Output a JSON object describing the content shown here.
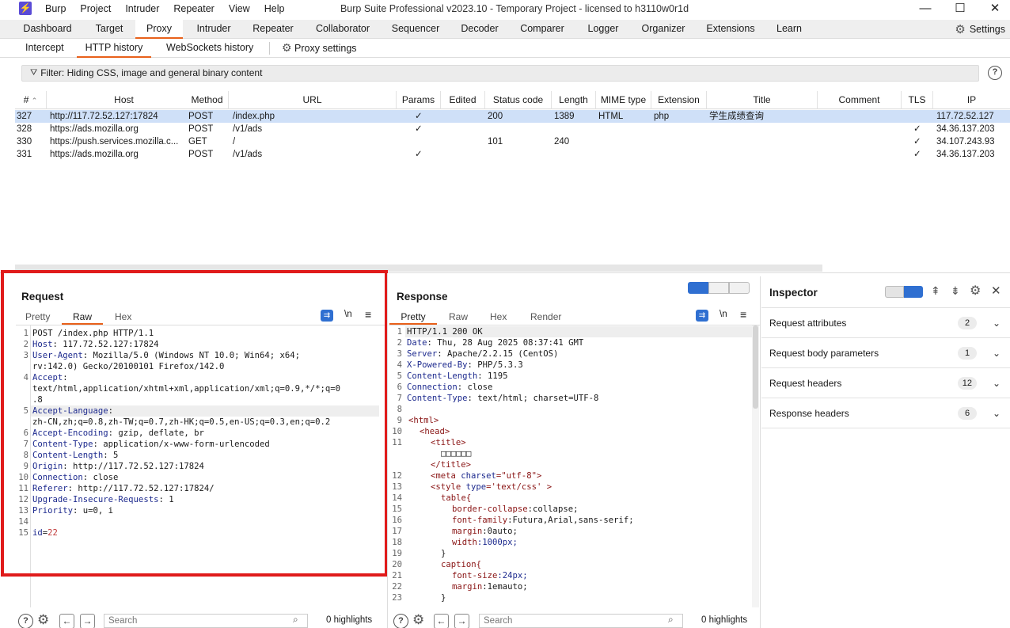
{
  "app": {
    "title": "Burp Suite Professional v2023.10 - Temporary Project - licensed to h3110w0r1d",
    "menu": [
      "Burp",
      "Project",
      "Intruder",
      "Repeater",
      "View",
      "Help"
    ],
    "logo_glyph": "⚡"
  },
  "top_tabs": [
    "Dashboard",
    "Target",
    "Proxy",
    "Intruder",
    "Repeater",
    "Collaborator",
    "Sequencer",
    "Decoder",
    "Comparer",
    "Logger",
    "Organizer",
    "Extensions",
    "Learn"
  ],
  "settings_label": "Settings",
  "sub_tabs": [
    "Intercept",
    "HTTP history",
    "WebSockets history"
  ],
  "proxy_settings_label": "Proxy settings",
  "filter_text": "Filter: Hiding CSS, image and general binary content",
  "columns": [
    "#",
    "Host",
    "Method",
    "URL",
    "Params",
    "Edited",
    "Status code",
    "Length",
    "MIME type",
    "Extension",
    "Title",
    "Comment",
    "TLS",
    "IP"
  ],
  "rows": [
    {
      "id": "327",
      "host": "http://117.72.52.127:17824",
      "method": "POST",
      "url": "/index.php",
      "params": "✓",
      "edited": "",
      "status": "200",
      "length": "1389",
      "mime": "HTML",
      "ext": "php",
      "title": "学生成绩查询",
      "comment": "",
      "tls": "",
      "ip": "117.72.52.127"
    },
    {
      "id": "328",
      "host": "https://ads.mozilla.org",
      "method": "POST",
      "url": "/v1/ads",
      "params": "✓",
      "edited": "",
      "status": "",
      "length": "",
      "mime": "",
      "ext": "",
      "title": "",
      "comment": "",
      "tls": "✓",
      "ip": "34.36.137.203"
    },
    {
      "id": "330",
      "host": "https://push.services.mozilla.c...",
      "method": "GET",
      "url": "/",
      "params": "",
      "edited": "",
      "status": "101",
      "length": "240",
      "mime": "",
      "ext": "",
      "title": "",
      "comment": "",
      "tls": "✓",
      "ip": "34.107.243.93"
    },
    {
      "id": "331",
      "host": "https://ads.mozilla.org",
      "method": "POST",
      "url": "/v1/ads",
      "params": "✓",
      "edited": "",
      "status": "",
      "length": "",
      "mime": "",
      "ext": "",
      "title": "",
      "comment": "",
      "tls": "✓",
      "ip": "34.36.137.203"
    }
  ],
  "request": {
    "title": "Request",
    "tabs": [
      "Pretty",
      "Raw",
      "Hex"
    ],
    "active_tab": "Raw",
    "newline_label": "\\n",
    "lines": [
      {
        "n": "1",
        "text": "POST /index.php HTTP/1.1"
      },
      {
        "n": "2",
        "key": "Host",
        "val": ": 117.72.52.127:17824"
      },
      {
        "n": "3",
        "key": "User-Agent",
        "val": ": Mozilla/5.0 (Windows NT 10.0; Win64; x64;"
      },
      {
        "n": "",
        "text": "rv:142.0) Gecko/20100101 Firefox/142.0"
      },
      {
        "n": "4",
        "key": "Accept",
        "val": ":"
      },
      {
        "n": "",
        "text": "text/html,application/xhtml+xml,application/xml;q=0.9,*/*;q=0"
      },
      {
        "n": "",
        "text": ".8"
      },
      {
        "n": "5",
        "key": "Accept-Language",
        "val": ":"
      },
      {
        "n": "",
        "text": "zh-CN,zh;q=0.8,zh-TW;q=0.7,zh-HK;q=0.5,en-US;q=0.3,en;q=0.2"
      },
      {
        "n": "6",
        "key": "Accept-Encoding",
        "val": ": gzip, deflate, br"
      },
      {
        "n": "7",
        "key": "Content-Type",
        "val": ": application/x-www-form-urlencoded"
      },
      {
        "n": "8",
        "key": "Content-Length",
        "val": ": 5"
      },
      {
        "n": "9",
        "key": "Origin",
        "val": ": http://117.72.52.127:17824"
      },
      {
        "n": "10",
        "key": "Connection",
        "val": ": close"
      },
      {
        "n": "11",
        "key": "Referer",
        "val": ": http://117.72.52.127:17824/"
      },
      {
        "n": "12",
        "key": "Upgrade-Insecure-Requests",
        "val": ": 1"
      },
      {
        "n": "13",
        "key": "Priority",
        "val": ": u=0, i"
      },
      {
        "n": "14",
        "text": ""
      },
      {
        "n": "15",
        "param": "id",
        "pval": "22"
      }
    ],
    "search_placeholder": "Search",
    "highlights": "0 highlights"
  },
  "response": {
    "title": "Response",
    "tabs": [
      "Pretty",
      "Raw",
      "Hex",
      "Render"
    ],
    "active_tab": "Pretty",
    "newline_label": "\\n",
    "lines": [
      {
        "n": "1",
        "text": "HTTP/1.1 200 OK"
      },
      {
        "n": "2",
        "key": "Date",
        "val": ": Thu, 28 Aug 2025 08:37:41 GMT"
      },
      {
        "n": "3",
        "key": "Server",
        "val": ": Apache/2.2.15 (CentOS)"
      },
      {
        "n": "4",
        "key": "X-Powered-By",
        "val": ": PHP/5.3.3"
      },
      {
        "n": "5",
        "key": "Content-Length",
        "val": ": 1195"
      },
      {
        "n": "6",
        "key": "Connection",
        "val": ": close"
      },
      {
        "n": "7",
        "key": "Content-Type",
        "val": ": text/html; charset=UTF-8"
      },
      {
        "n": "8",
        "text": ""
      },
      {
        "n": "9",
        "indent": 0,
        "tag": "<html>"
      },
      {
        "n": "10",
        "indent": 1,
        "tag": "<head>"
      },
      {
        "n": "11",
        "indent": 2,
        "tag": "<title>"
      },
      {
        "n": "",
        "indent": 3,
        "text": "□□□□□□"
      },
      {
        "n": "",
        "indent": 2,
        "tag": "</title>"
      },
      {
        "n": "12",
        "indent": 2,
        "tag": "<meta",
        "attr": " charset",
        "str": "=\"utf-8\"",
        "close": ">"
      },
      {
        "n": "13",
        "indent": 2,
        "tag": "<style",
        "attr": " type",
        "str": "='text/css'",
        "close": " >"
      },
      {
        "n": "14",
        "indent": 3,
        "css": "table{"
      },
      {
        "n": "15",
        "indent": 4,
        "prop": "border-collapse",
        "cval": ":collapse;"
      },
      {
        "n": "16",
        "indent": 4,
        "prop": "font-family",
        "cval": ":Futura,Arial,sans-serif;"
      },
      {
        "n": "17",
        "indent": 4,
        "prop": "margin",
        "cval": ":0auto;"
      },
      {
        "n": "18",
        "indent": 4,
        "prop": "width",
        "num": ":1000px;"
      },
      {
        "n": "19",
        "indent": 3,
        "css": "}"
      },
      {
        "n": "20",
        "indent": 3,
        "css": "caption{"
      },
      {
        "n": "21",
        "indent": 4,
        "prop": "font-size",
        "num": ":24px;"
      },
      {
        "n": "22",
        "indent": 4,
        "prop": "margin",
        "cval": ":1emauto;"
      },
      {
        "n": "23",
        "indent": 3,
        "css": "}"
      }
    ],
    "search_placeholder": "Search",
    "highlights": "0 highlights"
  },
  "inspector": {
    "title": "Inspector",
    "sections": [
      {
        "label": "Request attributes",
        "count": "2"
      },
      {
        "label": "Request body parameters",
        "count": "1"
      },
      {
        "label": "Request headers",
        "count": "12"
      },
      {
        "label": "Response headers",
        "count": "6"
      }
    ]
  },
  "colors": {
    "accent": "#e8611b",
    "selection": "#cfe0f8",
    "highlight_box": "#e01b1b",
    "header_key": "#1d2a8e"
  }
}
